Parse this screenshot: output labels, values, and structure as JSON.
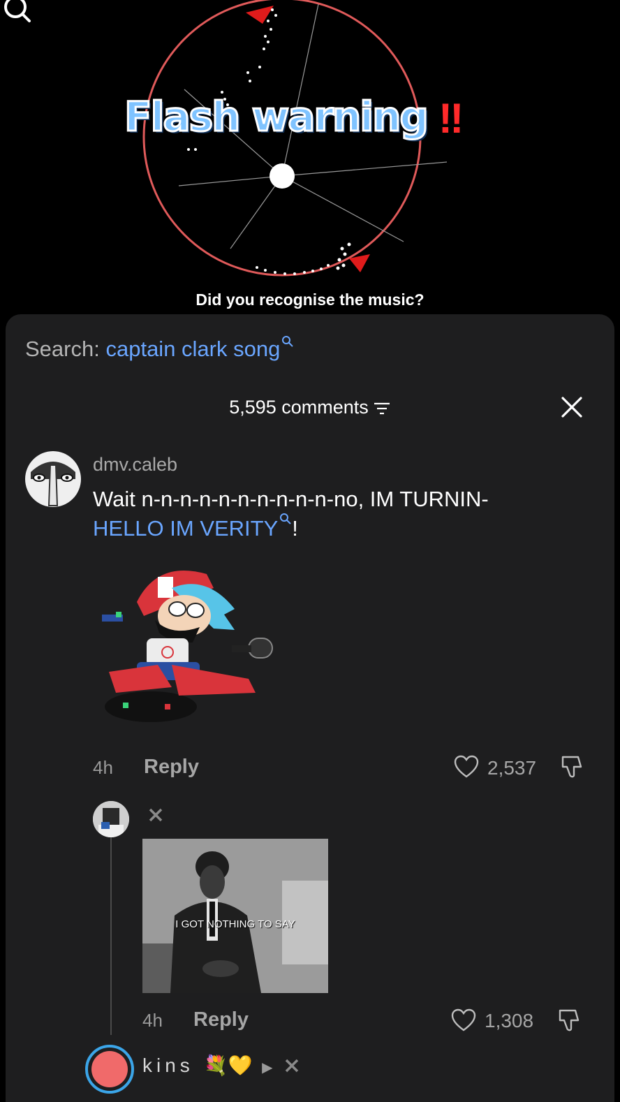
{
  "video": {
    "overlay_title": "Flash warning",
    "overlay_mark": "‼",
    "caption": "Did you recognise the music?"
  },
  "sheet": {
    "search_label": "Search:",
    "search_query": "captain clark song",
    "comments_count": "5,595 comments"
  },
  "comments": [
    {
      "username": "dmv.caleb",
      "text_plain": "Wait n-n-n-n-n-n-n-n-n-n-no, IM TURNIN-",
      "text_link": "HELLO IM VERITY",
      "text_after": "!",
      "time": "4h",
      "reply_label": "Reply",
      "likes": "2,537"
    },
    {
      "username": "",
      "media_caption": "I GOT NOTHING TO SAY",
      "time": "4h",
      "reply_label": "Reply",
      "likes": "1,308"
    },
    {
      "username": "kins"
    }
  ],
  "colors": {
    "sheet_bg": "#1e1e1f",
    "link": "#6aa6ff",
    "circle": "#e05a5a",
    "warning": "#ff2a2a"
  }
}
